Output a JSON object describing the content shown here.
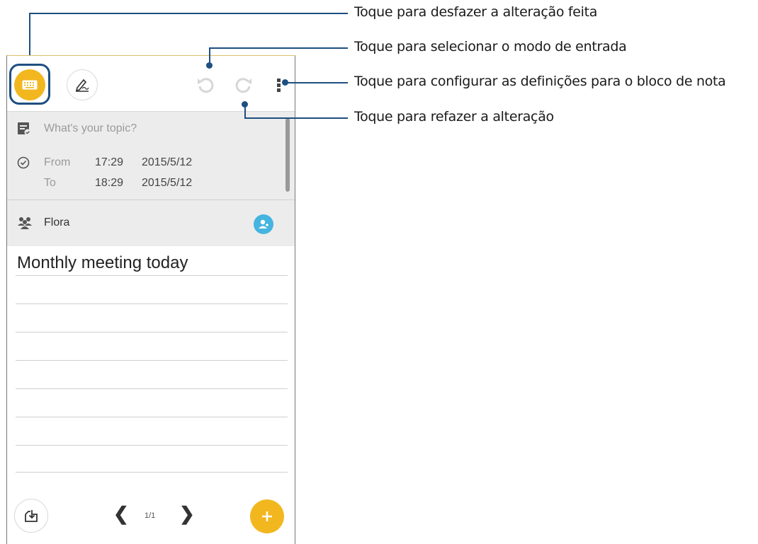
{
  "callouts": {
    "undo": "Toque para desfazer a alteração feita",
    "input_mode": "Toque para selecionar o modo de entrada",
    "settings": "Toque para configurar as definições para o bloco de nota",
    "redo": "Toque para refazer a alteração"
  },
  "note": {
    "topic_placeholder": "What's your topic?",
    "from_label": "From",
    "to_label": "To",
    "from_time": "17:29",
    "from_date": "2015/5/12",
    "to_time": "18:29",
    "to_date": "2015/5/12",
    "attendee": "Flora",
    "body_text": "Monthly meeting today"
  },
  "pager": {
    "text": "1/1",
    "prev": "❮",
    "next": "❯"
  },
  "icons": {
    "keyboard": "keyboard-icon",
    "pen": "handwriting-icon",
    "undo": "undo-icon",
    "redo": "redo-icon",
    "menu": "more-vertical-icon",
    "topic": "topic-icon",
    "clock": "clock-icon",
    "people": "people-icon",
    "add_person": "add-person-icon",
    "import": "import-icon",
    "add": "plus-icon"
  },
  "colors": {
    "accent": "#f2b71f",
    "callout_line": "#1d4f82",
    "add_person": "#45b4e0"
  }
}
